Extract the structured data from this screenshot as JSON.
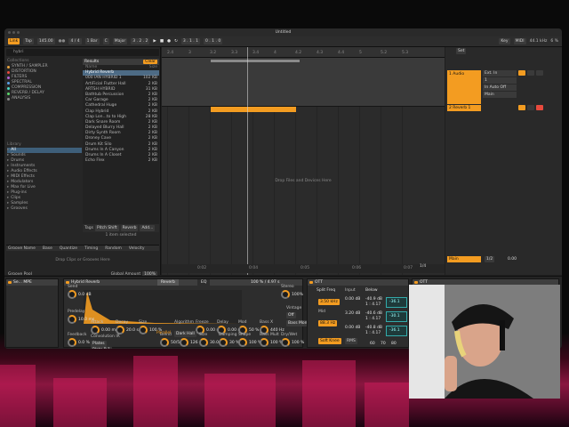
{
  "app": {
    "title": "Untitled"
  },
  "transport": {
    "link": "Link",
    "tap": "Tap",
    "tempo": "145.00",
    "time_sig": "4 / 4",
    "quantize": "1 Bar",
    "key": "C",
    "scale": "Major",
    "position": "3 . 2 . 2",
    "loop_start": "3 . 1 . 1",
    "loop_length": "0 . 1 . 0",
    "key_label": "Key",
    "midi_label": "MIDI",
    "sample_rate": "44.1 kHz",
    "cpu": "6 %"
  },
  "browser": {
    "search": "hybri",
    "collections_header": "Collections",
    "collections": [
      {
        "label": "SYNTH / SAMPLER",
        "color": "#e8a33d"
      },
      {
        "label": "DISTORTION",
        "color": "#e84a3d"
      },
      {
        "label": "FILTERS",
        "color": "#b061d6"
      },
      {
        "label": "SPECTRAL",
        "color": "#5aa0e8"
      },
      {
        "label": "COMPRESSION",
        "color": "#4ad6c4"
      },
      {
        "label": "REVERB / DELAY",
        "color": "#5ad66a"
      },
      {
        "label": "ANALYSIS",
        "color": "#8a8a8a"
      }
    ],
    "library_header": "Library",
    "library": [
      "All",
      "Sounds",
      "Drums",
      "Instruments",
      "Audio Effects",
      "MIDI Effects",
      "Modulators",
      "Max for Live",
      "Plug-ins",
      "Clips",
      "Samples",
      "Grooves"
    ],
    "results": {
      "label": "Results",
      "tag": "Clear",
      "col_name": "Name",
      "col_size": "Size",
      "items": [
        {
          "name": "Hybrid Reverb",
          "size": ""
        },
        {
          "name": "000 IAN HYBRID 1",
          "size": "102 KB"
        },
        {
          "name": "ArtiFicial Flutter Hall",
          "size": "2 KB"
        },
        {
          "name": "ARTSH HYBRID",
          "size": "31 KB"
        },
        {
          "name": "Bathtub Percussion",
          "size": "2 KB"
        },
        {
          "name": "Car Garage",
          "size": "2 KB"
        },
        {
          "name": "Cathedral Huge",
          "size": "2 KB"
        },
        {
          "name": "Clap Hybrid",
          "size": "2 KB"
        },
        {
          "name": "Clap Lon...to to High",
          "size": "28 KB"
        },
        {
          "name": "Dark Snare Room",
          "size": "2 KB"
        },
        {
          "name": "Delayed Blurry Hall",
          "size": "2 KB"
        },
        {
          "name": "Dirty Synth Room",
          "size": "2 KB"
        },
        {
          "name": "Droney Cave",
          "size": "2 KB"
        },
        {
          "name": "Drum Kit Silo",
          "size": "2 KB"
        },
        {
          "name": "Drums In A Canyon",
          "size": "2 KB"
        },
        {
          "name": "Drums In A Closet",
          "size": "2 KB"
        },
        {
          "name": "Echo Flex",
          "size": "2 KB"
        }
      ]
    },
    "tags": [
      "Tags",
      "Pitch Shift",
      "Reverb",
      "Add..."
    ],
    "item_selected": "1 item selected",
    "groove": {
      "col_name": "Groove Name",
      "col_base": "Base",
      "col_quantize": "Quantize",
      "col_timing": "Timing",
      "col_random": "Random",
      "col_velocity": "Velocity",
      "hint": "Drop Clips or Grooves Here",
      "pool": "Groove Pool",
      "global_amount_label": "Global Amount",
      "global_amount": "100%"
    }
  },
  "arrangement": {
    "ruler": [
      "2.4",
      "3",
      "3.2",
      "3.3",
      "3.4",
      "4",
      "4.2",
      "4.3",
      "4.4",
      "5",
      "5.2",
      "5.3"
    ],
    "drop_hint": "Drop Files and Devices Here",
    "time_labels": [
      "0:02",
      "0:04",
      "0:05",
      "0:06",
      "0:07"
    ],
    "zoom": "1/4"
  },
  "mixer": {
    "set": "Set",
    "track1": "1 Audio",
    "track2": "2 Reverb 1",
    "main": "Main",
    "input": "Ext. In",
    "channel": "1",
    "monitor": "In  Auto  Off",
    "output": "Main",
    "master_val": "0.00",
    "master_ratio": "1/2"
  },
  "devices": {
    "delay_device": "Se... MPE",
    "reverb": {
      "title": "Hybrid Reverb",
      "tab_reverb": "Reverb",
      "tab_eq": "EQ",
      "size_readout": "100 % / 4.97 s",
      "send_label": "Send",
      "send_val": "0.0 dB",
      "predelay_label": "Predelay",
      "predelay_val": "10.0 ms",
      "attack_label": "Attack",
      "attack_val": "0.00 ms",
      "decay_label": "Decay",
      "decay_val": "20.0 s",
      "size_label": "Size",
      "size_val": "100 %",
      "routing_label": "Parallel",
      "algorithm_label": "Algorithm",
      "algorithm_val": "Dark Hall",
      "freeze_label": "Freeze",
      "freeze_val": "0.00 ms",
      "delay_label": "Delay",
      "delay_val": "0.00 ms",
      "mod_label": "Mod",
      "mod_val": "50 %",
      "basex_label": "Bass X",
      "basex_val": "440 Hz",
      "convolution_label": "Convolution IR",
      "ir_category": "Plates",
      "ir_file": "Plate B 1",
      "feedback_label": "Feedback",
      "feedback_val": "0.0 %",
      "blend_label": "Blend",
      "blend_val": "50/50",
      "decay2_label": "Decay",
      "decay2_val": "126 ms",
      "size2_label": "Size",
      "size2_val": "30.0",
      "damping_label": "Damping",
      "damping_val": "30 %",
      "shape_label": "Shape",
      "shape_val": "100 %",
      "bassmult_label": "Bass Mult",
      "bassmult_val": "100 %",
      "drywet_label": "Dry/Wet",
      "drywet_val": "100 %",
      "stereo_label": "Stereo",
      "stereo_val": "100%",
      "vintage_label": "Vintage",
      "vintage_val": "Off",
      "bassmono_label": "Bass Mono"
    },
    "ott": {
      "title": "OTT",
      "split_label": "Split Freq",
      "high_val": "3.50 kHz",
      "mid_label": "Mid",
      "low_val": "88.3 Hz",
      "input_label": "Input",
      "input_vals": [
        "0.00 dB",
        "3.20 dB",
        "0.00 dB"
      ],
      "below_label": "Below",
      "thresholds": [
        "-40.9 dB",
        "-40.6 dB",
        "-40.8 dB"
      ],
      "ratios": [
        "1 : 4.17",
        "1 : 4.17",
        "1 : 4.17"
      ],
      "above": [
        "-36.1",
        "-30.1",
        "-36.1"
      ],
      "soft_knee": "Soft Knee",
      "rms": "RMS",
      "output_vals": [
        "60",
        "70",
        "80"
      ]
    }
  },
  "colors": {
    "accent": "#f39c21",
    "selection": "#4d6b85",
    "city": "#c81e5a"
  }
}
